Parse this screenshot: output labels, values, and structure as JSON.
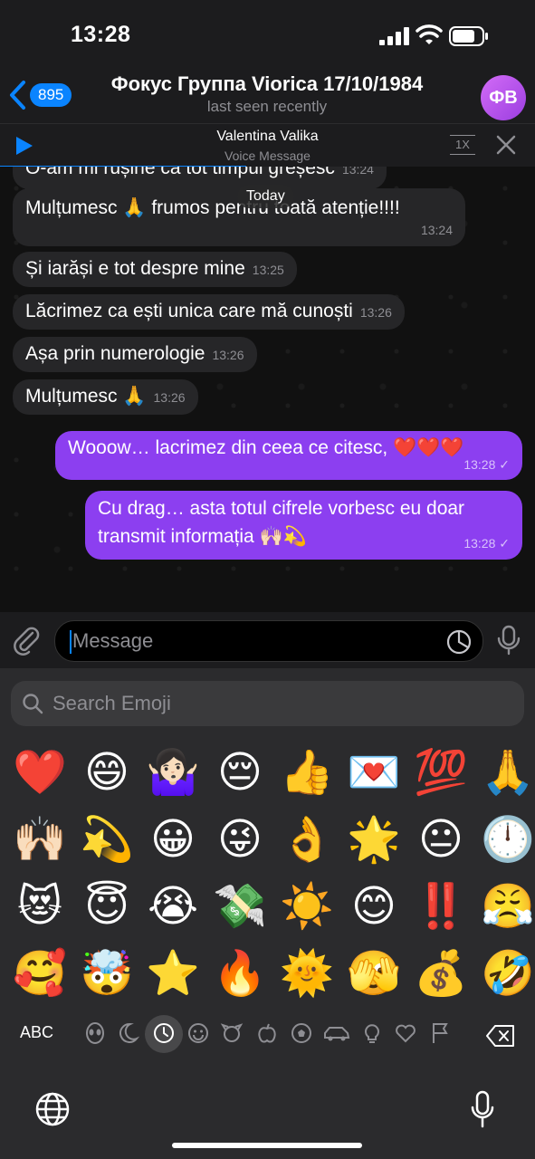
{
  "status_bar": {
    "time": "13:28"
  },
  "header": {
    "back_count": "895",
    "title": "Фокус Группа Viorica 17/10/1984",
    "subtitle": "last seen recently",
    "avatar_initials": "ФВ"
  },
  "audio_player": {
    "name": "Valentina Valika",
    "subtitle": "Voice Message",
    "speed": "1X",
    "progress": 0.46
  },
  "chat": {
    "date_label": "Today",
    "partial_message": {
      "text": "O-am mi rușine ca tot timpul greșesc",
      "time": "13:24"
    },
    "messages": [
      {
        "dir": "in",
        "text": "Mulțumesc 🙏 frumos pentru toată atenție!!!!",
        "time": "13:24"
      },
      {
        "dir": "in",
        "text": "Și iarăși e tot despre mine",
        "time": "13:25"
      },
      {
        "dir": "in",
        "text": "Lăcrimez ca ești unica care mă cunoști",
        "time": "13:26"
      },
      {
        "dir": "in",
        "text": "Așa prin numerologie",
        "time": "13:26"
      },
      {
        "dir": "in",
        "text": "Mulțumesc 🙏",
        "time": "13:26"
      },
      {
        "dir": "out",
        "text": "Wooow… lacrimez din ceea ce citesc, ❤️❤️❤️",
        "time": "13:28",
        "check": "✓"
      },
      {
        "dir": "out",
        "line1": "Cu drag… asta totul cifrele vorbesc eu doar",
        "line2": "transmit informația 🙌🏻💫",
        "time": "13:28",
        "check": "✓"
      }
    ]
  },
  "composer": {
    "placeholder": "Message"
  },
  "emoji_keyboard": {
    "search_placeholder": "Search Emoji",
    "emojis": [
      "❤️",
      "😄",
      "🤷🏻‍♀️",
      "😔",
      "👍",
      "💌",
      "💯",
      "🙏",
      "🙌🏻",
      "💫",
      "😀",
      "😜",
      "👌",
      "🌟",
      "😐",
      "🕛",
      "😻",
      "😇",
      "😭",
      "💸",
      "☀️",
      "😊",
      "‼️",
      "😤",
      "🥰",
      "🤯",
      "⭐",
      "🔥",
      "🌞",
      "🫣",
      "💰",
      "🤣"
    ],
    "abc_label": "ABC",
    "selected_category": "recent"
  }
}
